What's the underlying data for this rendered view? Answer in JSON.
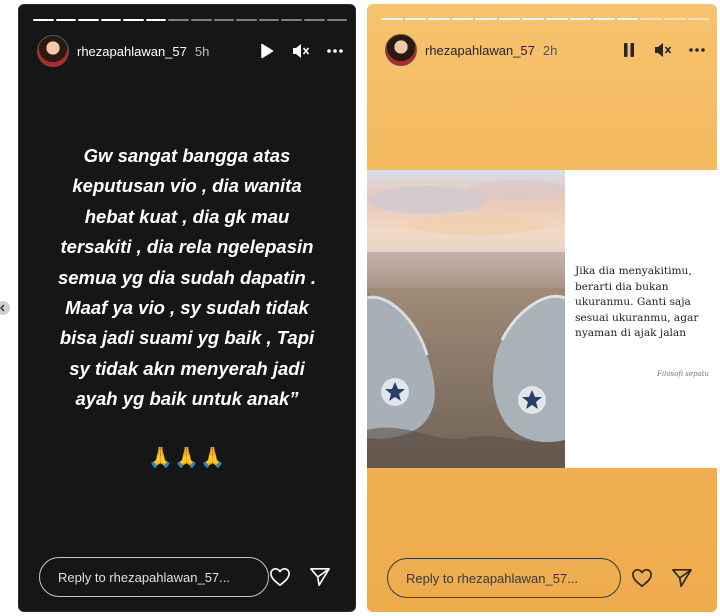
{
  "story_left": {
    "username": "rhezapahlawan_57",
    "time": "5h",
    "quote": "Gw sangat bangga atas keputusan vio , dia wanita hebat kuat , dia gk mau tersakiti , dia rela ngelepasin semua yg dia sudah dapatin . Maaf ya vio , sy sudah tidak bisa jadi suami yg baik , Tapi sy tidak akn menyerah jadi ayah yg baik untuk anak”",
    "emoji": "🙏🙏🙏",
    "reply_placeholder": "Reply to rhezapahlawan_57...",
    "icons": [
      "play-icon",
      "mute-icon",
      "more-icon",
      "heart-icon",
      "send-icon"
    ]
  },
  "story_right": {
    "username": "rhezapahlawan_57",
    "time": "2h",
    "photo_text": "Jika dia menyakitimu, berarti dia bukan ukuranmu. Ganti saja sesuai ukuranmu, agar nyaman di ajak jalan",
    "photo_signature": "Filosofi sepatu",
    "reply_placeholder": "Reply to rhezapahlawan_57...",
    "icons": [
      "pause-icon",
      "mute-icon",
      "more-icon",
      "heart-icon",
      "send-icon"
    ]
  },
  "colors": {
    "left_bg": "#161616",
    "right_bg": "#f2b457"
  }
}
